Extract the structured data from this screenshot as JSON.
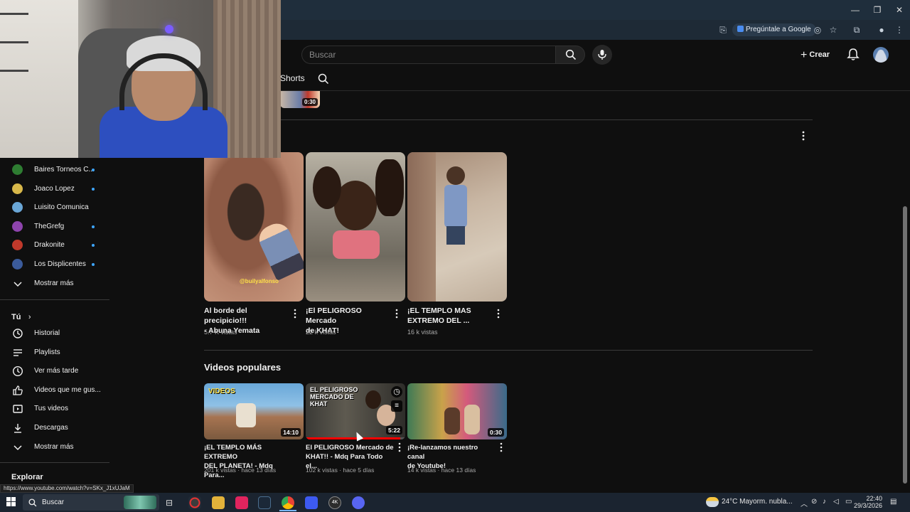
{
  "browser": {
    "ask_google_label": "Pregúntale a Google",
    "window_controls": [
      "—",
      "❐",
      "✕"
    ]
  },
  "header": {
    "search_placeholder": "Buscar",
    "create_label": "Crear"
  },
  "channel_tabs": {
    "shorts_label": "Shorts",
    "top_short_duration": "0:30"
  },
  "sidebar": {
    "subscriptions": [
      {
        "name": "Baires Torneos C...",
        "new": true,
        "color": "#2e7d32"
      },
      {
        "name": "Joaco Lopez",
        "new": true,
        "color": "#d8b84a"
      },
      {
        "name": "Luisito Comunica",
        "new": false,
        "color": "#6aa6d6"
      },
      {
        "name": "TheGrefg",
        "new": true,
        "color": "#8e44ad"
      },
      {
        "name": "Drakonite",
        "new": true,
        "color": "#c0392b"
      },
      {
        "name": "Los Displicentes",
        "new": true,
        "color": "#3b5b9b"
      }
    ],
    "show_more_1": "Mostrar más",
    "you_heading": "Tú",
    "you_items": [
      {
        "label": "Historial",
        "icon": "history-icon"
      },
      {
        "label": "Playlists",
        "icon": "playlists-icon"
      },
      {
        "label": "Ver más tarde",
        "icon": "watch-later-icon"
      },
      {
        "label": "Videos que me gus...",
        "icon": "like-icon"
      },
      {
        "label": "Tus videos",
        "icon": "your-videos-icon"
      },
      {
        "label": "Descargas",
        "icon": "downloads-icon"
      }
    ],
    "show_more_2": "Mostrar más",
    "explore_heading": "Explorar"
  },
  "shorts": [
    {
      "title_line1": "Al borde del precipicio!!!",
      "title_line2": "- Abuna Yemata",
      "views": "5.7 K vistas",
      "watermark": "@builyalfonso"
    },
    {
      "title_line1": "¡El PELIGROSO Mercado",
      "title_line2": "de KHAT!",
      "views": "22 k vistas"
    },
    {
      "title_line1": "¡EL TEMPLO MAS",
      "title_line2": "EXTREMO DEL ...",
      "views": "16 k vistas"
    }
  ],
  "popular": {
    "heading": "Videos populares",
    "videos": [
      {
        "title_line1": "¡EL TEMPLO MÁS EXTREMO",
        "title_line2": "DEL PLANETA! - Mdq Para...",
        "meta": "201 k vistas · hace 13 días",
        "duration": "14:10",
        "overlay_text": "VIDEOS"
      },
      {
        "title_line1": "El PELIGROSO Mercado de",
        "title_line2": "KHAT!! - Mdq Para Todo el...",
        "meta": "102 k vistas · hace 5 días",
        "duration": "5:22",
        "overlay_text": "EL PELIGROSO MERCADO DE KHAT",
        "progress": 0.95
      },
      {
        "title_line1": "¡Re-lanzamos nuestro canal",
        "title_line2": "de Youtube!",
        "meta": "14 k vistas · hace 13 días",
        "duration": "0:30"
      }
    ]
  },
  "status_url": "https://www.youtube.com/watch?v=SKx_J1xUJaM",
  "taskbar": {
    "search_label": "Buscar",
    "weather": "24°C  Mayorm. nubla...",
    "time": "22:40",
    "date": "29/3/2026"
  }
}
